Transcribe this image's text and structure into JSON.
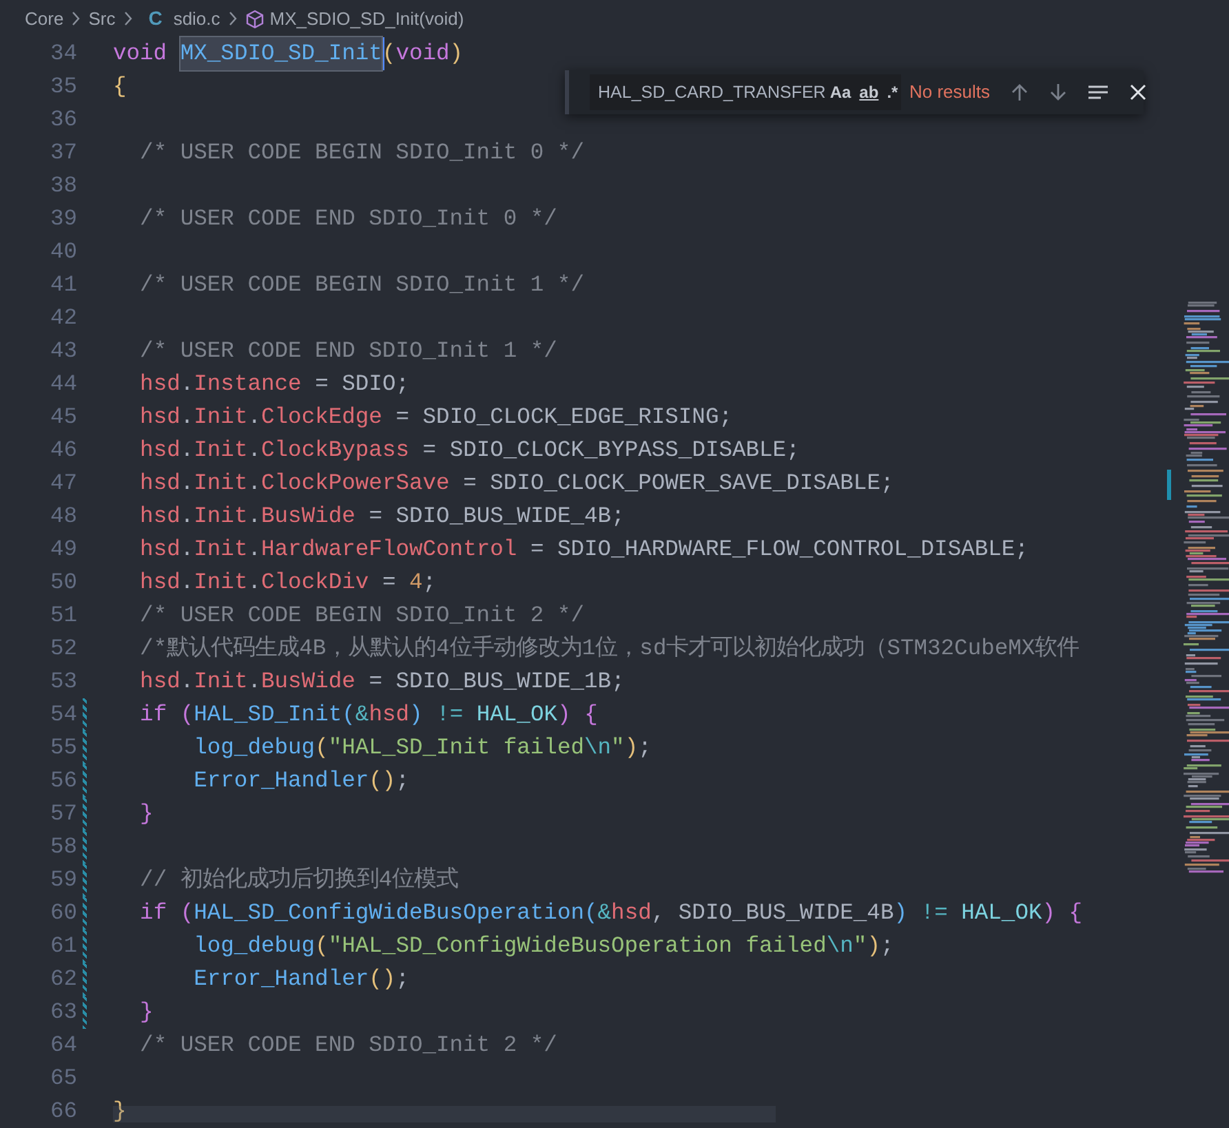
{
  "breadcrumbs": [
    {
      "label": "Core",
      "kind": "folder"
    },
    {
      "label": "Src",
      "kind": "folder"
    },
    {
      "label": "sdio.c",
      "kind": "file",
      "icon": "C"
    },
    {
      "label": "MX_SDIO_SD_Init(void)",
      "kind": "symbol"
    }
  ],
  "find_widget": {
    "value": "HAL_SD_CARD_TRANSFER",
    "options": [
      {
        "label": "Aa",
        "selected": false
      },
      {
        "label": "ab",
        "selected": false
      },
      {
        "label": ".*",
        "selected": false
      }
    ],
    "status": "No results"
  },
  "lines": [
    {
      "number": "34",
      "changed": false,
      "tokens": [
        {
          "text": "void ",
          "kind": "kw"
        },
        {
          "text": "MX_SDIO_SD_Init",
          "kind": "fn",
          "selected": true
        },
        {
          "text": "(",
          "kind": "br1"
        },
        {
          "text": "void",
          "kind": "kw"
        },
        {
          "text": ")",
          "kind": "br1"
        }
      ]
    },
    {
      "number": "35",
      "changed": false,
      "tokens": [
        {
          "text": "{",
          "kind": "br1"
        }
      ]
    },
    {
      "number": "36",
      "changed": false
    },
    {
      "number": "37",
      "changed": false,
      "tokens": [
        {
          "text": "  /* USER CODE BEGIN SDIO_Init 0 */",
          "kind": "cmt"
        }
      ]
    },
    {
      "number": "38",
      "changed": false
    },
    {
      "number": "39",
      "changed": false,
      "tokens": [
        {
          "text": "  /* USER CODE END SDIO_Init 0 */",
          "kind": "cmt"
        }
      ]
    },
    {
      "number": "40",
      "changed": false
    },
    {
      "number": "41",
      "changed": false,
      "tokens": [
        {
          "text": "  /* USER CODE BEGIN SDIO_Init 1 */",
          "kind": "cmt"
        }
      ]
    },
    {
      "number": "42",
      "changed": false
    },
    {
      "number": "43",
      "changed": false,
      "tokens": [
        {
          "text": "  /* USER CODE END SDIO_Init 1 */",
          "kind": "cmt"
        }
      ]
    },
    {
      "number": "44",
      "changed": false,
      "tokens": [
        {
          "text": "  hsd",
          "kind": "var"
        },
        {
          "text": ".",
          "kind": "plain"
        },
        {
          "text": "Instance",
          "kind": "var"
        },
        {
          "text": " = SDIO;",
          "kind": "plain"
        }
      ]
    },
    {
      "number": "45",
      "changed": false,
      "tokens": [
        {
          "text": "  hsd",
          "kind": "var"
        },
        {
          "text": ".",
          "kind": "plain"
        },
        {
          "text": "Init",
          "kind": "var"
        },
        {
          "text": ".",
          "kind": "plain"
        },
        {
          "text": "ClockEdge",
          "kind": "var"
        },
        {
          "text": " = SDIO_CLOCK_EDGE_RISING;",
          "kind": "plain"
        }
      ]
    },
    {
      "number": "46",
      "changed": false,
      "tokens": [
        {
          "text": "  hsd",
          "kind": "var"
        },
        {
          "text": ".",
          "kind": "plain"
        },
        {
          "text": "Init",
          "kind": "var"
        },
        {
          "text": ".",
          "kind": "plain"
        },
        {
          "text": "ClockBypass",
          "kind": "var"
        },
        {
          "text": " = SDIO_CLOCK_BYPASS_DISABLE;",
          "kind": "plain"
        }
      ]
    },
    {
      "number": "47",
      "changed": false,
      "tokens": [
        {
          "text": "  hsd",
          "kind": "var"
        },
        {
          "text": ".",
          "kind": "plain"
        },
        {
          "text": "Init",
          "kind": "var"
        },
        {
          "text": ".",
          "kind": "plain"
        },
        {
          "text": "ClockPowerSave",
          "kind": "var"
        },
        {
          "text": " = SDIO_CLOCK_POWER_SAVE_DISABLE;",
          "kind": "plain"
        }
      ]
    },
    {
      "number": "48",
      "changed": false,
      "tokens": [
        {
          "text": "  hsd",
          "kind": "var"
        },
        {
          "text": ".",
          "kind": "plain"
        },
        {
          "text": "Init",
          "kind": "var"
        },
        {
          "text": ".",
          "kind": "plain"
        },
        {
          "text": "BusWide",
          "kind": "var"
        },
        {
          "text": " = SDIO_BUS_WIDE_4B;",
          "kind": "plain"
        }
      ]
    },
    {
      "number": "49",
      "changed": false,
      "tokens": [
        {
          "text": "  hsd",
          "kind": "var"
        },
        {
          "text": ".",
          "kind": "plain"
        },
        {
          "text": "Init",
          "kind": "var"
        },
        {
          "text": ".",
          "kind": "plain"
        },
        {
          "text": "HardwareFlowControl",
          "kind": "var"
        },
        {
          "text": " = SDIO_HARDWARE_FLOW_CONTROL_DISABLE;",
          "kind": "plain"
        }
      ]
    },
    {
      "number": "50",
      "changed": false,
      "tokens": [
        {
          "text": "  hsd",
          "kind": "var"
        },
        {
          "text": ".",
          "kind": "plain"
        },
        {
          "text": "Init",
          "kind": "var"
        },
        {
          "text": ".",
          "kind": "plain"
        },
        {
          "text": "ClockDiv",
          "kind": "var"
        },
        {
          "text": " = ",
          "kind": "plain"
        },
        {
          "text": "4",
          "kind": "num"
        },
        {
          "text": ";",
          "kind": "plain"
        }
      ]
    },
    {
      "number": "51",
      "changed": false,
      "tokens": [
        {
          "text": "  /* USER CODE BEGIN SDIO_Init 2 */",
          "kind": "cmt"
        }
      ]
    },
    {
      "number": "52",
      "changed": false,
      "tokens": [
        {
          "text": "  /*默认代码生成4B，从默认的4位手动修改为1位，sd卡才可以初始化成功（STM32CubeMX软件",
          "kind": "cmt"
        }
      ]
    },
    {
      "number": "53",
      "changed": false,
      "tokens": [
        {
          "text": "  hsd",
          "kind": "var"
        },
        {
          "text": ".",
          "kind": "plain"
        },
        {
          "text": "Init",
          "kind": "var"
        },
        {
          "text": ".",
          "kind": "plain"
        },
        {
          "text": "BusWide",
          "kind": "var"
        },
        {
          "text": " = SDIO_BUS_WIDE_1B;",
          "kind": "plain"
        }
      ]
    },
    {
      "number": "54",
      "changed": true,
      "tokens": [
        {
          "text": "  if ",
          "kind": "kw"
        },
        {
          "text": "(",
          "kind": "br2"
        },
        {
          "text": "HAL_SD_Init",
          "kind": "fn"
        },
        {
          "text": "(",
          "kind": "br3"
        },
        {
          "text": "&",
          "kind": "op"
        },
        {
          "text": "hsd",
          "kind": "var"
        },
        {
          "text": ")",
          "kind": "br3"
        },
        {
          "text": " != ",
          "kind": "op"
        },
        {
          "text": "HAL_OK",
          "kind": "const"
        },
        {
          "text": ")",
          "kind": "br2"
        },
        {
          "text": " {",
          "kind": "br2"
        }
      ]
    },
    {
      "number": "55",
      "changed": true,
      "tokens": [
        {
          "text": "      log_debug",
          "kind": "fn"
        },
        {
          "text": "(",
          "kind": "br1"
        },
        {
          "text": "\"HAL_SD_Init failed",
          "kind": "str"
        },
        {
          "text": "\\n",
          "kind": "esc"
        },
        {
          "text": "\"",
          "kind": "str"
        },
        {
          "text": ")",
          "kind": "br1"
        },
        {
          "text": ";",
          "kind": "plain"
        }
      ]
    },
    {
      "number": "56",
      "changed": true,
      "tokens": [
        {
          "text": "      Error_Handler",
          "kind": "fn"
        },
        {
          "text": "()",
          "kind": "br1"
        },
        {
          "text": ";",
          "kind": "plain"
        }
      ]
    },
    {
      "number": "57",
      "changed": true,
      "tokens": [
        {
          "text": "  }",
          "kind": "br2"
        }
      ]
    },
    {
      "number": "58",
      "changed": true
    },
    {
      "number": "59",
      "changed": true,
      "tokens": [
        {
          "text": "  // 初始化成功后切换到4位模式",
          "kind": "cmt"
        }
      ]
    },
    {
      "number": "60",
      "changed": true,
      "tokens": [
        {
          "text": "  if ",
          "kind": "kw"
        },
        {
          "text": "(",
          "kind": "br2"
        },
        {
          "text": "HAL_SD_ConfigWideBusOperation",
          "kind": "fn"
        },
        {
          "text": "(",
          "kind": "br3"
        },
        {
          "text": "&",
          "kind": "op"
        },
        {
          "text": "hsd",
          "kind": "var"
        },
        {
          "text": ", SDIO_BUS_WIDE_4B",
          "kind": "plain"
        },
        {
          "text": ")",
          "kind": "br3"
        },
        {
          "text": " != ",
          "kind": "op"
        },
        {
          "text": "HAL_OK",
          "kind": "const"
        },
        {
          "text": ")",
          "kind": "br2"
        },
        {
          "text": " {",
          "kind": "br2"
        }
      ]
    },
    {
      "number": "61",
      "changed": true,
      "tokens": [
        {
          "text": "      log_debug",
          "kind": "fn"
        },
        {
          "text": "(",
          "kind": "br1"
        },
        {
          "text": "\"HAL_SD_ConfigWideBusOperation failed",
          "kind": "str"
        },
        {
          "text": "\\n",
          "kind": "esc"
        },
        {
          "text": "\"",
          "kind": "str"
        },
        {
          "text": ")",
          "kind": "br1"
        },
        {
          "text": ";",
          "kind": "plain"
        }
      ]
    },
    {
      "number": "62",
      "changed": true,
      "tokens": [
        {
          "text": "      Error_Handler",
          "kind": "fn"
        },
        {
          "text": "()",
          "kind": "br1"
        },
        {
          "text": ";",
          "kind": "plain"
        }
      ]
    },
    {
      "number": "63",
      "changed": true,
      "tokens": [
        {
          "text": "  }",
          "kind": "br2"
        }
      ]
    },
    {
      "number": "64",
      "changed": false,
      "tokens": [
        {
          "text": "  /* USER CODE END SDIO_Init 2 */",
          "kind": "cmt"
        }
      ]
    },
    {
      "number": "65",
      "changed": false
    },
    {
      "number": "66",
      "changed": false,
      "tokens": [
        {
          "text": "}",
          "kind": "br1"
        }
      ]
    }
  ]
}
